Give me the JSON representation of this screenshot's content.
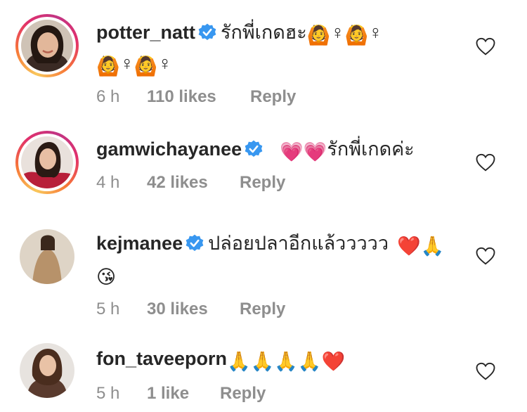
{
  "comments": [
    {
      "username": "potter_natt",
      "text_line1": "รักพี่เกดฮะ",
      "line1_tail": [
        "🙆",
        "‍♀",
        "🙆",
        "‍♀"
      ],
      "line2": [
        "🙆",
        "‍♀",
        "🙆",
        "‍♀"
      ],
      "time": "6 h",
      "likes": "110 likes",
      "reply": "Reply"
    },
    {
      "username": "gamwichayanee",
      "emoji_prefix": [
        "💗",
        "💗"
      ],
      "text_line1": "รักพี่เกดค่ะ",
      "time": "4 h",
      "likes": "42 likes",
      "reply": "Reply"
    },
    {
      "username": "kejmanee",
      "text_line1": "ปล่อยปลาอีกแล้ววววว",
      "line1_tail": [
        "❤️",
        "🙏",
        "‍"
      ],
      "line2": [
        "😘"
      ],
      "time": "5 h",
      "likes": "30 likes",
      "reply": "Reply"
    },
    {
      "username": "fon_taveeporn",
      "emoji_suffix": [
        "🙏",
        "🙏",
        "🙏",
        "🙏",
        "❤️"
      ],
      "time": "5 h",
      "likes": "1 like",
      "reply": "Reply"
    }
  ],
  "icons": {
    "verified": "verified-badge-icon",
    "like": "heart-outline-icon"
  },
  "colors": {
    "verified_blue": "#3897f0",
    "meta_gray": "#8e8e8e",
    "heart_red": "#e8112d",
    "pink_heart": "#f472b6"
  }
}
